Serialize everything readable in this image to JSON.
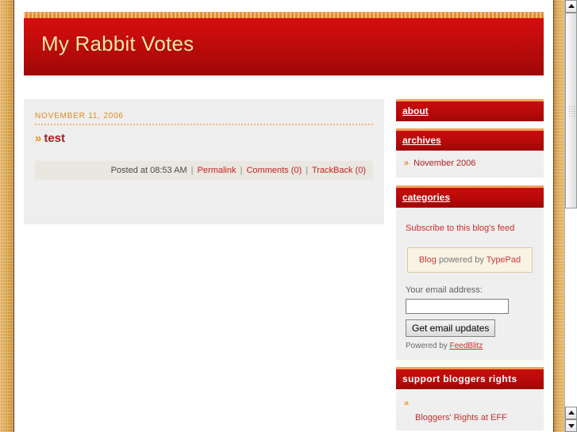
{
  "banner": {
    "title": "My Rabbit Votes"
  },
  "post": {
    "date": "NOVEMBER 11, 2006",
    "chevron": "»",
    "title": "test",
    "posted_at": "Posted at 08:53 AM",
    "permalink_label": "Permalink",
    "comments_label": "Comments (0)",
    "trackback_label": "TrackBack (0)",
    "separator": "|"
  },
  "sidebar": {
    "about": {
      "heading": "about"
    },
    "archives": {
      "heading": "archives",
      "items": [
        {
          "chevron": "»",
          "label": "November 2006"
        }
      ]
    },
    "categories": {
      "heading": "categories"
    },
    "feed": {
      "link_label": "Subscribe to this blog's feed"
    },
    "typepad": {
      "brand_prefix": "Blog",
      "middle": " powered by ",
      "brand_suffix": "TypePad"
    },
    "email": {
      "label": "Your email address:",
      "value": "",
      "placeholder": "",
      "button_label": "Get email updates",
      "powered_prefix": "Powered by ",
      "powered_brand": "FeedBlitz"
    },
    "bloggers_rights": {
      "heading": "support bloggers rights",
      "chevron": "»",
      "link_label": "Bloggers' Rights at EFF"
    }
  },
  "colors": {
    "banner_red": "#c90c0c",
    "accent_orange": "#ef8b1e",
    "link_red": "#cc2222",
    "title_yellow": "#ffe9a0",
    "border_tan": "#d9a450",
    "panel_gray": "#efefef"
  }
}
